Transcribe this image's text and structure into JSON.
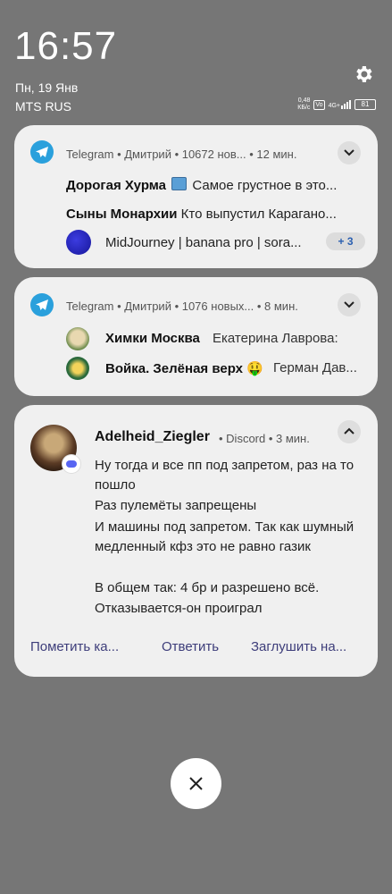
{
  "status": {
    "time": "16:57",
    "date": "Пн, 19 Янв",
    "carrier": "MTS RUS",
    "speed_value": "0,48",
    "speed_unit": "КБ/с",
    "volte": "Vo",
    "network": "4G+",
    "battery": "81"
  },
  "notifications": [
    {
      "app": "Telegram",
      "header": "Telegram • Дмитрий • 10672 нов... • 12 мин.",
      "rows": [
        {
          "title": "Дорогая Хурма",
          "text": "Самое грустное в это..."
        },
        {
          "title": "Сыны Монархии",
          "text": "Кто выпустил Карагано..."
        },
        {
          "title": "MidJourney | banana pro | sora...",
          "text": ""
        }
      ],
      "more": "+ 3"
    },
    {
      "app": "Telegram",
      "header": "Telegram • Дмитрий • 1076 новых... • 8 мин.",
      "rows": [
        {
          "title": "Химки Москва",
          "text": "Екатерина Лаврова:"
        },
        {
          "title": "Войка. Зелёная верх 🤑",
          "text": "Герман Дав..."
        }
      ]
    },
    {
      "app": "Discord",
      "user": "Adelheid_Ziegler",
      "meta": "• Discord • 3 мин.",
      "messages": [
        "Ну тогда и все пп под запретом, раз на то пошло",
        "Раз пулемёты запрещены",
        "И машины под запретом. Так как шумный медленный кфз это не равно газик",
        "В общем так: 4 бр и разрешено всё.",
        "Отказывается-он проиграл"
      ],
      "actions": [
        "Пометить ка...",
        "Ответить",
        "Заглушить на..."
      ]
    }
  ],
  "icons": {
    "settings": "gear-icon",
    "telegram": "telegram-icon",
    "expand": "chevron-down-icon",
    "collapse": "chevron-up-icon",
    "discord": "discord-icon",
    "close": "close-icon"
  },
  "colors": {
    "background": "#767676",
    "card": "#f0f0f0",
    "telegram": "#2aa0dc",
    "discord": "#5865f2",
    "action": "#3d3d7a"
  }
}
